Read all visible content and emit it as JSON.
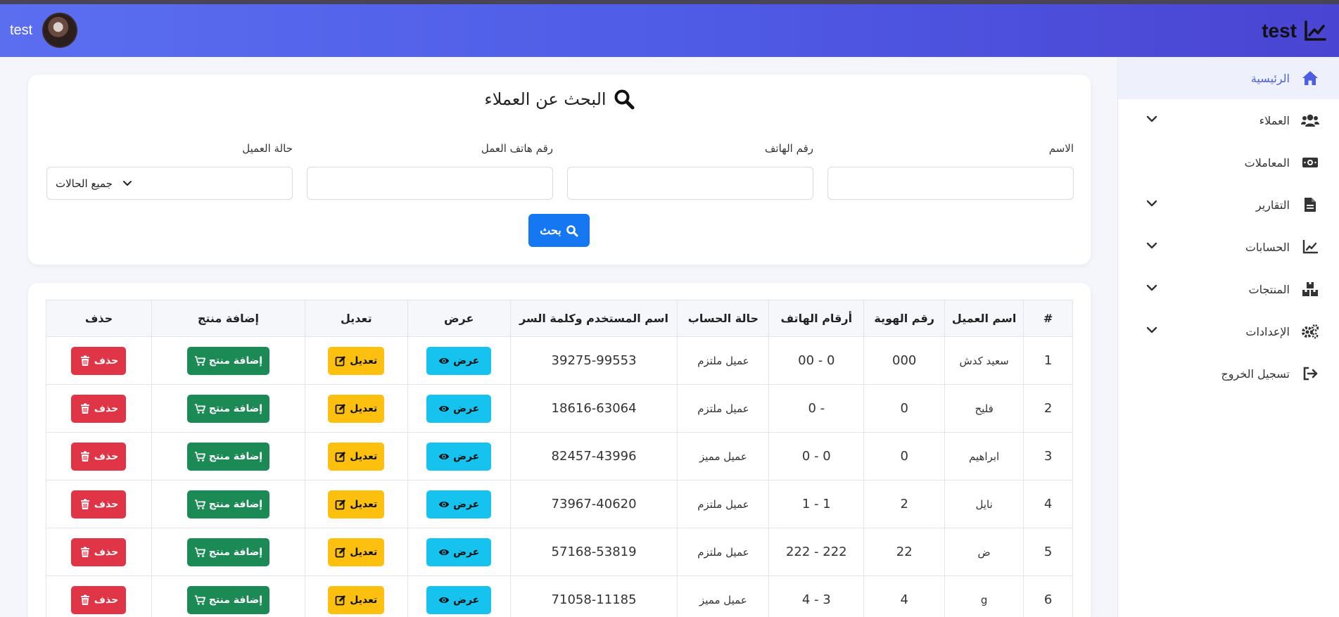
{
  "navbar": {
    "brand": "test",
    "user_name": "test"
  },
  "sidebar": {
    "items": [
      {
        "label": "الرئيسية",
        "icon": "home-icon",
        "active": true,
        "dropdown": false
      },
      {
        "label": "العملاء",
        "icon": "users-icon",
        "active": false,
        "dropdown": true
      },
      {
        "label": "المعاملات",
        "icon": "money-icon",
        "active": false,
        "dropdown": false
      },
      {
        "label": "التقارير",
        "icon": "file-icon",
        "active": false,
        "dropdown": true
      },
      {
        "label": "الحسابات",
        "icon": "chart-line-icon",
        "active": false,
        "dropdown": true
      },
      {
        "label": "المنتجات",
        "icon": "boxes-icon",
        "active": false,
        "dropdown": true
      },
      {
        "label": "الإعدادات",
        "icon": "gears-icon",
        "active": false,
        "dropdown": true
      },
      {
        "label": "تسجيل الخروج",
        "icon": "logout-icon",
        "active": false,
        "dropdown": false
      }
    ]
  },
  "search": {
    "title": "البحث عن العملاء",
    "name_label": "الاسم",
    "phone_label": "رقم الهاتف",
    "work_phone_label": "رقم هاتف العمل",
    "status_label": "حالة العميل",
    "status_value": "جميع الحالات",
    "button_label": "بحث"
  },
  "table": {
    "headers": [
      "#",
      "اسم العميل",
      "رقم الهوية",
      "أرقام الهاتف",
      "حالة الحساب",
      "اسم المستخدم وكلمة السر",
      "عرض",
      "تعديل",
      "إضافة منتج",
      "حذف"
    ],
    "actions": {
      "view": "عرض",
      "edit": "تعديل",
      "add": "إضافة منتج",
      "delete": "حذف"
    },
    "rows": [
      {
        "num": "1",
        "name": "سعيد كدش",
        "id": "000",
        "phones": "0 - 00",
        "status": "عميل ملتزم",
        "credentials": "39275-99553"
      },
      {
        "num": "2",
        "name": "فليح",
        "id": "0",
        "phones": "- 0",
        "status": "عميل ملتزم",
        "credentials": "18616-63064"
      },
      {
        "num": "3",
        "name": "ابراهيم",
        "id": "0",
        "phones": "0 - 0",
        "status": "عميل مميز",
        "credentials": "82457-43996"
      },
      {
        "num": "4",
        "name": "نايل",
        "id": "2",
        "phones": "1 - 1",
        "status": "عميل ملتزم",
        "credentials": "73967-40620"
      },
      {
        "num": "5",
        "name": "ض",
        "id": "22",
        "phones": "222 - 222",
        "status": "عميل ملتزم",
        "credentials": "57168-53819"
      },
      {
        "num": "6",
        "name": "g",
        "id": "4",
        "phones": "3 - 4",
        "status": "عميل مميز",
        "credentials": "71058-11185"
      }
    ]
  },
  "colors": {
    "primary": "#1677f2",
    "view": "#15c3ee",
    "edit": "#fdc00f",
    "add": "#1c8a54",
    "delete": "#e03546",
    "navbar": "#4f5ce6"
  }
}
